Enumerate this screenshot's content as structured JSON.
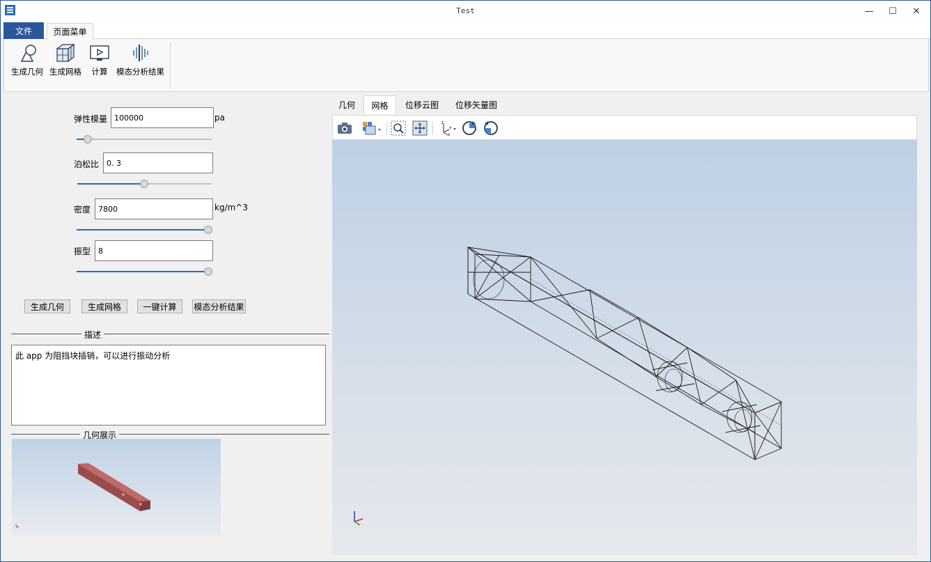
{
  "window": {
    "title": "Test",
    "minimize": "—",
    "maximize": "☐",
    "close": "✕"
  },
  "menu": {
    "file": "文件",
    "page_menu": "页面菜单"
  },
  "ribbon": {
    "buttons": [
      {
        "label": "生成几何",
        "icon": "geometry-icon"
      },
      {
        "label": "生成网格",
        "icon": "mesh-icon"
      },
      {
        "label": "计算",
        "icon": "compute-icon"
      },
      {
        "label": "模态分析结果",
        "icon": "modal-result-icon"
      }
    ]
  },
  "params": {
    "elastic_modulus": {
      "label": "弹性模量",
      "value": "100000",
      "unit": "pa",
      "slider": 0.08
    },
    "poisson": {
      "label": "泊松比",
      "value": "0. 3",
      "slider": 0.5
    },
    "density": {
      "label": "密度",
      "value": "7800",
      "unit": "kg/m^3",
      "slider": 1.0
    },
    "mode": {
      "label": "振型",
      "value": "8",
      "slider": 1.0
    }
  },
  "actions": {
    "gen_geometry": "生成几何",
    "gen_mesh": "生成网格",
    "compute": "一键计算",
    "modal_result": "模态分析结果"
  },
  "description": {
    "title": "描述",
    "text": "此 app 为阻挡块插销，可以进行振动分析"
  },
  "geometry_preview": {
    "title": "几何展示"
  },
  "tabs": [
    {
      "label": "几何",
      "active": false
    },
    {
      "label": "网格",
      "active": true
    },
    {
      "label": "位移云图",
      "active": false
    },
    {
      "label": "位移矢量图",
      "active": false
    }
  ],
  "toolbar_icons": [
    "camera-icon",
    "view-cube-icon",
    "zoom-box-icon",
    "fit-view-icon",
    "axes-icon",
    "rotate-cw-icon",
    "rotate-ccw-icon"
  ],
  "colors": {
    "accent": "#2b579a",
    "slider_fill": "#1f6fb9",
    "block": "#a85b5b"
  }
}
